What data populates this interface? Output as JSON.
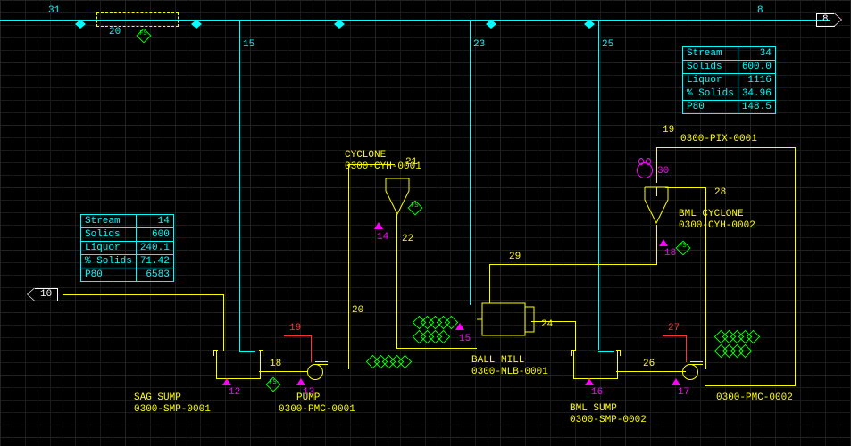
{
  "streams": {
    "s31": "31",
    "s20": "20",
    "s15": "15",
    "s23": "23",
    "s25": "25",
    "s8": "8",
    "s8out": "8",
    "s19a": "19",
    "s21": "21",
    "s14m": "14",
    "s22": "22",
    "s29": "29",
    "s24": "24",
    "s18": "18",
    "s19r": "19",
    "s20d": "20",
    "s15m": "15",
    "s13": "13",
    "s12": "12",
    "s10": "10",
    "s16": "16",
    "s17": "17",
    "s26": "26",
    "s27": "27",
    "s28": "28",
    "s30": "30",
    "s18m": "18",
    "s34": "34"
  },
  "equip": {
    "cyclone": {
      "name": "CYCLONE",
      "tag": "0300-CYH-0001"
    },
    "bml_cyclone": {
      "name": "BML CYCLONE",
      "tag": "0300-CYH-0002"
    },
    "sag_sump": {
      "name": "SAG SUMP",
      "tag": "0300-SMP-0001"
    },
    "bml_sump": {
      "name": "BML SUMP",
      "tag": "0300-SMP-0002"
    },
    "pump1": {
      "name": "PUMP",
      "tag": "0300-PMC-0001"
    },
    "pump2": {
      "tag": "0300-PMC-0002"
    },
    "ball_mill": {
      "name": "BALL MILL",
      "tag": "0300-MLB-0001"
    },
    "pix": {
      "tag": "0300-PIX-0001"
    }
  },
  "table1": {
    "r1": {
      "k": "Stream",
      "v": "14"
    },
    "r2": {
      "k": "Solids",
      "v": "600"
    },
    "r3": {
      "k": "Liquor",
      "v": "240.1"
    },
    "r4": {
      "k": "% Solids",
      "v": "71.42"
    },
    "r5": {
      "k": "P80",
      "v": "6583"
    }
  },
  "table2": {
    "r1": {
      "k": "Stream",
      "v": "34"
    },
    "r2": {
      "k": "Solids",
      "v": "600.0"
    },
    "r3": {
      "k": "Liquor",
      "v": "1116"
    },
    "r4": {
      "k": "% Solids",
      "v": "34.96"
    },
    "r5": {
      "k": "P80",
      "v": "148.5"
    }
  }
}
